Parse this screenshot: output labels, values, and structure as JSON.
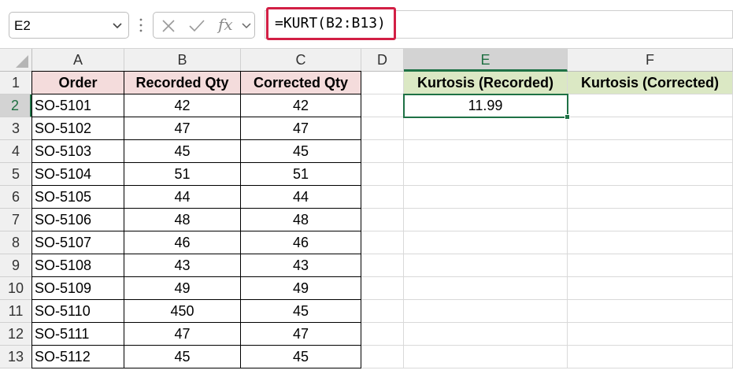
{
  "formula_bar": {
    "name_box": "E2",
    "formula": "=KURT(B2:B13)",
    "fx_label": "fx"
  },
  "columns": [
    "A",
    "B",
    "C",
    "D",
    "E",
    "F"
  ],
  "rows": [
    "1",
    "2",
    "3",
    "4",
    "5",
    "6",
    "7",
    "8",
    "9",
    "10",
    "11",
    "12",
    "13"
  ],
  "table": {
    "headers": [
      "Order",
      "Recorded Qty",
      "Corrected Qty"
    ],
    "rows": [
      [
        "SO-5101",
        "42",
        "42"
      ],
      [
        "SO-5102",
        "47",
        "47"
      ],
      [
        "SO-5103",
        "45",
        "45"
      ],
      [
        "SO-5104",
        "51",
        "51"
      ],
      [
        "SO-5105",
        "44",
        "44"
      ],
      [
        "SO-5106",
        "48",
        "48"
      ],
      [
        "SO-5107",
        "46",
        "46"
      ],
      [
        "SO-5108",
        "43",
        "43"
      ],
      [
        "SO-5109",
        "49",
        "49"
      ],
      [
        "SO-5110",
        "450",
        "45"
      ],
      [
        "SO-5111",
        "47",
        "47"
      ],
      [
        "SO-5112",
        "45",
        "45"
      ]
    ]
  },
  "results": {
    "headers": [
      "Kurtosis (Recorded)",
      "Kurtosis (Corrected)"
    ],
    "values": [
      "11.99",
      ""
    ]
  },
  "colors": {
    "accent": "#1e7145",
    "highlight_border": "#d21f45",
    "header_pink": "#f4dcdc",
    "header_green": "#dbe8c4"
  }
}
